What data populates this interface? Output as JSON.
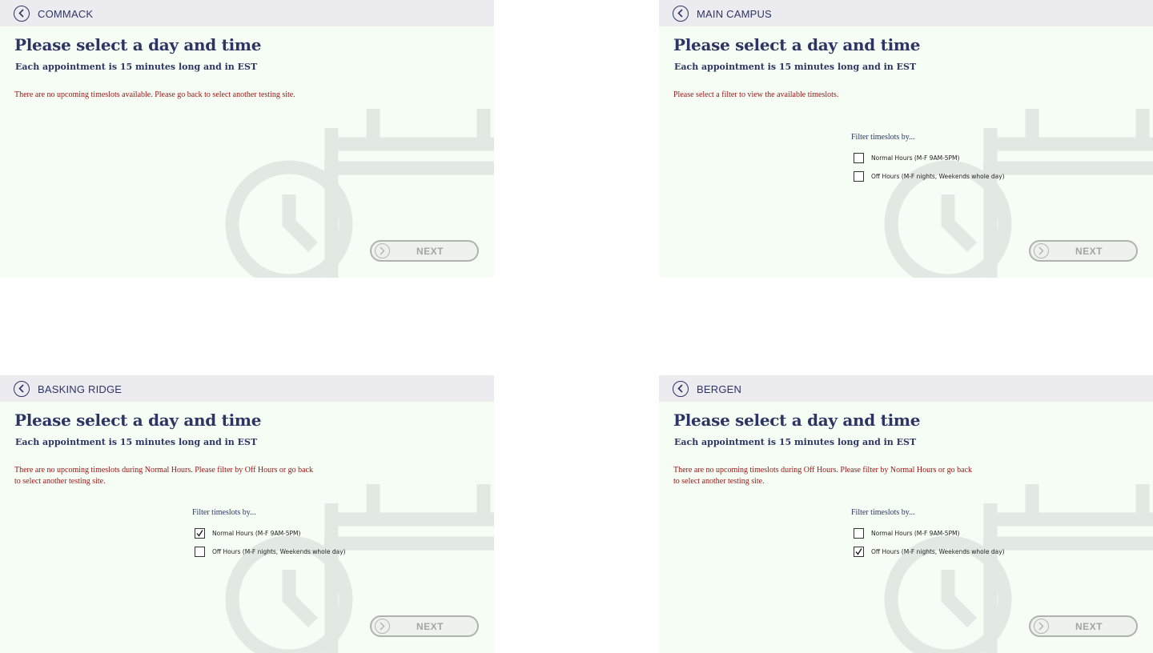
{
  "screens": [
    {
      "site_name": "COMMACK",
      "title": "Please select a day and time",
      "subtitle": "Each appointment is 15 minutes long and in EST",
      "message": "There are no upcoming timeslots available. Please go back to select another testing site.",
      "next_label": "NEXT"
    },
    {
      "site_name": "MAIN CAMPUS",
      "title": "Please select a day and time",
      "subtitle": "Each appointment is 15 minutes long and in EST",
      "message": "Please select a filter to view the available timeslots.",
      "filter": {
        "label": "Filter timeslots by...",
        "options": [
          {
            "label": "Normal Hours (M-F 9AM-5PM)",
            "checked": false
          },
          {
            "label": "Off Hours (M-F nights, Weekends whole day)",
            "checked": false
          }
        ]
      },
      "next_label": "NEXT"
    },
    {
      "site_name": "BASKING RIDGE",
      "title": "Please select a day and time",
      "subtitle": "Each appointment is 15 minutes long and in EST",
      "message": "There are no upcoming timeslots during Normal Hours. Please filter by Off Hours or go back to select another testing site.",
      "filter": {
        "label": "Filter timeslots by...",
        "options": [
          {
            "label": "Normal Hours (M-F 9AM-5PM)",
            "checked": true
          },
          {
            "label": "Off Hours (M-F nights, Weekends whole day)",
            "checked": false
          }
        ]
      },
      "next_label": "NEXT"
    },
    {
      "site_name": "BERGEN",
      "title": "Please select a day and time",
      "subtitle": "Each appointment is 15 minutes long and in EST",
      "message": "There are no upcoming timeslots during Off Hours. Please filter by Normal Hours or go back to select another testing site.",
      "filter": {
        "label": "Filter timeslots by...",
        "options": [
          {
            "label": "Normal Hours (M-F 9AM-5PM)",
            "checked": false
          },
          {
            "label": "Off Hours (M-F nights, Weekends whole day)",
            "checked": true
          }
        ]
      },
      "next_label": "NEXT"
    }
  ],
  "icons": {
    "back": "chevron-left-icon",
    "next": "chevron-right-icon",
    "checked": "checkmark-icon",
    "background": "calendar-clock-icon"
  },
  "colors": {
    "header_text": "#2e3564",
    "message_text": "#9b1212",
    "panel_background": "#f5fdf5",
    "topbar_background": "#ebebf0",
    "disabled_button": "#a2a6a2"
  }
}
